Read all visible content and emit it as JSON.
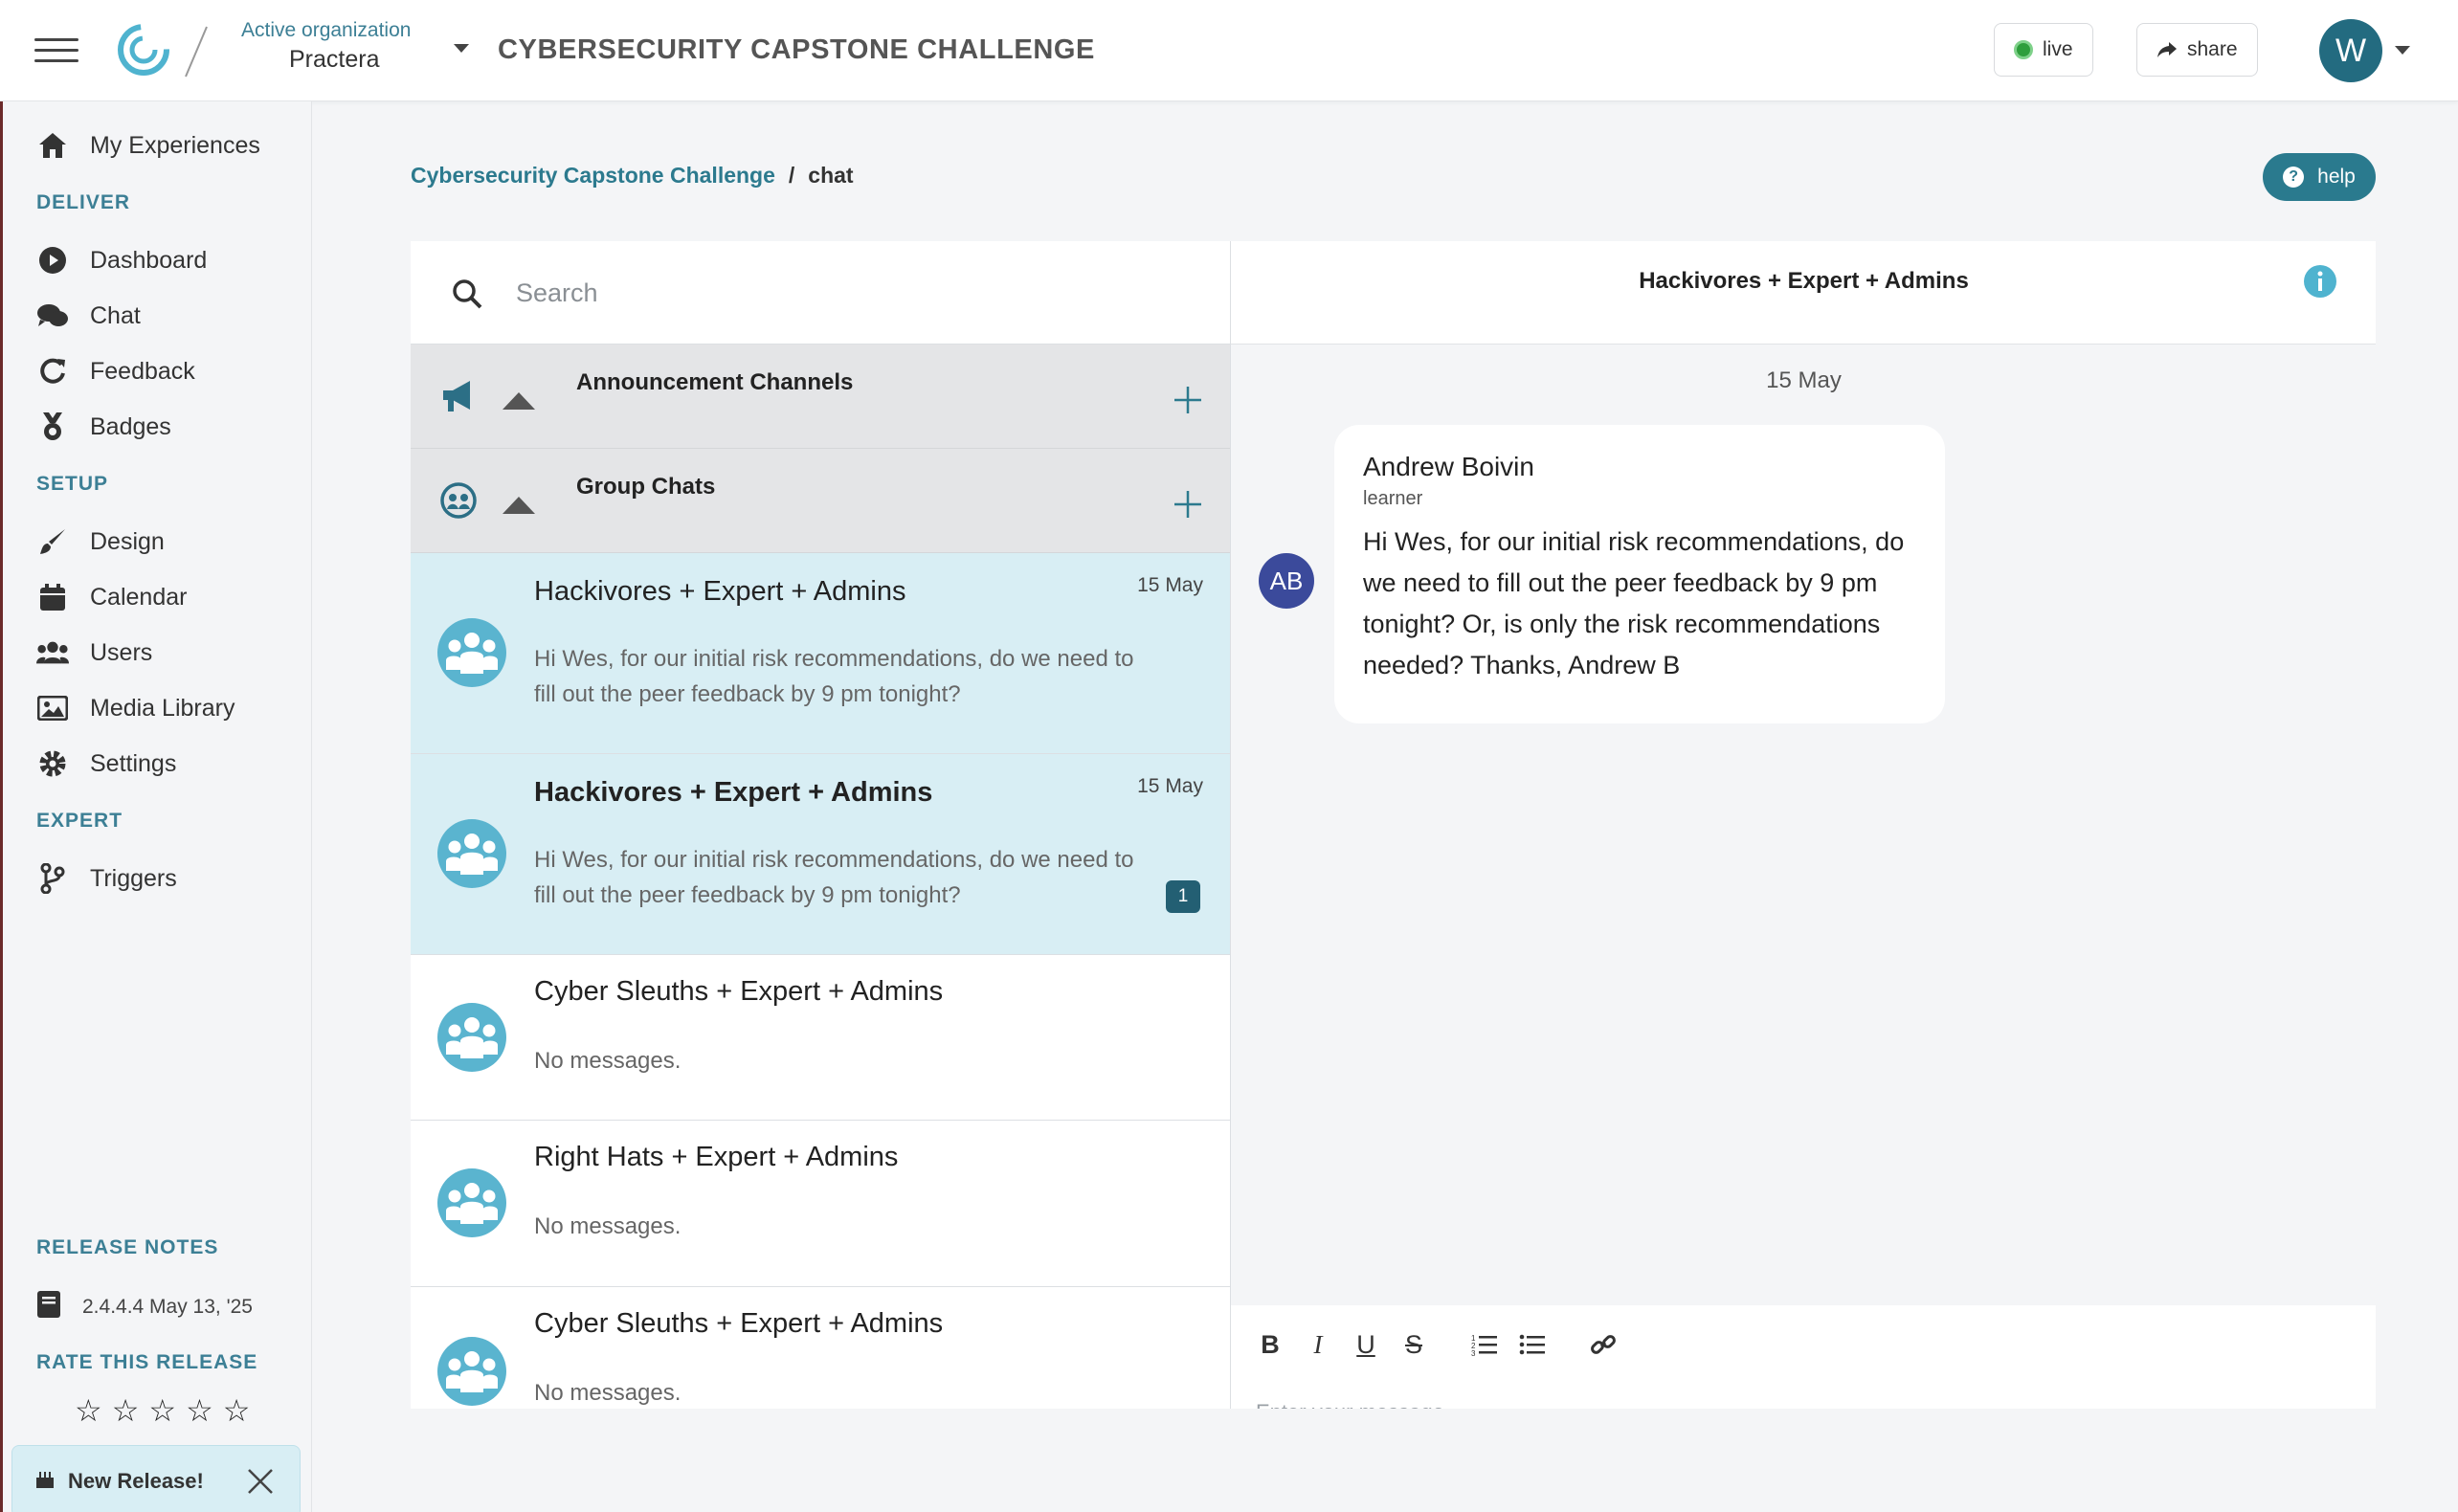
{
  "header": {
    "org_label": "Active organization",
    "org_name": "Practera",
    "app_title": "CYBERSECURITY CAPSTONE CHALLENGE",
    "live_label": "live",
    "share_label": "share",
    "avatar_initial": "W"
  },
  "sidebar": {
    "my_experiences": "My Experiences",
    "sections": {
      "deliver": "DELIVER",
      "setup": "SETUP",
      "expert": "EXPERT",
      "release_notes": "RELEASE NOTES",
      "rate": "RATE THIS RELEASE"
    },
    "deliver_items": [
      "Dashboard",
      "Chat",
      "Feedback",
      "Badges"
    ],
    "setup_items": [
      "Design",
      "Calendar",
      "Users",
      "Media Library",
      "Settings"
    ],
    "expert_items": [
      "Triggers"
    ],
    "release_version": "2.4.4.4 May 13, '25",
    "stars": [
      "☆",
      "☆",
      "☆",
      "☆",
      "☆"
    ],
    "new_release_label": "New Release!"
  },
  "breadcrumb": {
    "parent": "Cybersecurity Capstone Challenge",
    "separator": "/",
    "current": "chat"
  },
  "help_label": "help",
  "chat_list": {
    "search_placeholder": "Search",
    "sections": [
      "Announcement Channels",
      "Group Chats"
    ],
    "items": [
      {
        "name": "Hackivores + Expert + Admins",
        "date": "15 May",
        "message": "Hi Wes, for our initial risk recommendations, do we need to fill out the peer feedback by 9 pm tonight?",
        "unread": ""
      },
      {
        "name": "Hackivores + Expert + Admins",
        "date": "15 May",
        "message": "Hi Wes, for our initial risk recommendations, do we need to fill out the peer feedback by 9 pm tonight?",
        "unread": "1"
      },
      {
        "name": "Cyber Sleuths + Expert + Admins",
        "date": "",
        "message": "No messages.",
        "unread": ""
      },
      {
        "name": "Right Hats + Expert + Admins",
        "date": "",
        "message": "No messages.",
        "unread": ""
      },
      {
        "name": "Cyber Sleuths + Expert + Admins",
        "date": "",
        "message": "No messages.",
        "unread": ""
      }
    ]
  },
  "conversation": {
    "title": "Hackivores + Expert + Admins",
    "date_separator": "15 May",
    "message": {
      "avatar_initials": "AB",
      "sender": "Andrew Boivin",
      "role": "learner",
      "text": "Hi Wes, for our initial risk recommendations, do we need to fill out the peer feedback by 9 pm tonight? Or, is only the risk recommendations needed? Thanks, Andrew B"
    },
    "composer_placeholder": "Enter your message",
    "toolbar": {
      "bold": "B",
      "italic": "I",
      "underline": "U",
      "strike": "S"
    }
  },
  "colors": {
    "accent": "#2a7a8e",
    "active_row": "#d8eef4",
    "live_dot": "#2e9e3c",
    "avatar_ab": "#3b4a9b"
  },
  "icons": {
    "menu": "hamburger-icon",
    "share": "share-arrow-icon",
    "search": "search-icon",
    "megaphone": "megaphone-icon",
    "group": "group-chat-icon",
    "info": "info-icon"
  }
}
